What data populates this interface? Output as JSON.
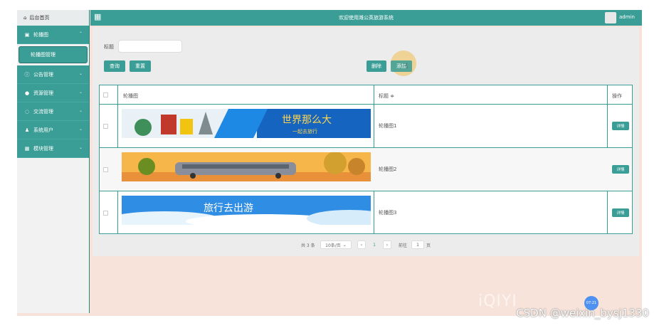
{
  "topbar": {
    "grid_icon": "grid-icon",
    "title": "欢迎使用潍公英旅游系统",
    "user": "admin"
  },
  "sidebar": {
    "home": "后台首页",
    "menus": [
      {
        "label": "轮播图",
        "icon": "image-icon"
      },
      {
        "label": "公告管理",
        "icon": "info-icon"
      },
      {
        "label": "资源管理",
        "icon": "pin-icon"
      },
      {
        "label": "交流管理",
        "icon": "chat-icon"
      },
      {
        "label": "系统用户",
        "icon": "user-icon"
      },
      {
        "label": "模块管理",
        "icon": "grid-icon"
      }
    ],
    "submenu": "轮播图管理"
  },
  "search": {
    "label": "标题",
    "value": "",
    "placeholder": ""
  },
  "buttons": {
    "query": "查询",
    "reset": "重置",
    "delete": "删除",
    "add": "添加"
  },
  "table": {
    "headers": {
      "banner": "轮播图",
      "title": "标题 ≑",
      "ops": "操作"
    },
    "rows": [
      {
        "title": "轮播图1",
        "detail": "详情",
        "banner_text": "世界那么大",
        "banner_sub": "一起去旅行",
        "banner_colors": [
          "#1565c0",
          "#ffd54f"
        ]
      },
      {
        "title": "轮播图2",
        "detail": "详情",
        "banner_text": "",
        "banner_sub": "",
        "banner_colors": [
          "#f7b64a",
          "#8a8d9a"
        ]
      },
      {
        "title": "轮播图3",
        "detail": "详情",
        "banner_text": "旅行去出游",
        "banner_sub": "",
        "banner_colors": [
          "#2f8de4",
          "#e8f4fc"
        ]
      }
    ]
  },
  "pager": {
    "total": "共 3 条",
    "page_size": "10条/页",
    "prev": "‹",
    "current": "1",
    "next": "›",
    "goto": "前往",
    "goto_value": "1",
    "page_unit": "页"
  },
  "overlay": {
    "watermark": "CSDN @weixin_bysj1330",
    "logo": "iQIYI",
    "badge": "07:21"
  }
}
